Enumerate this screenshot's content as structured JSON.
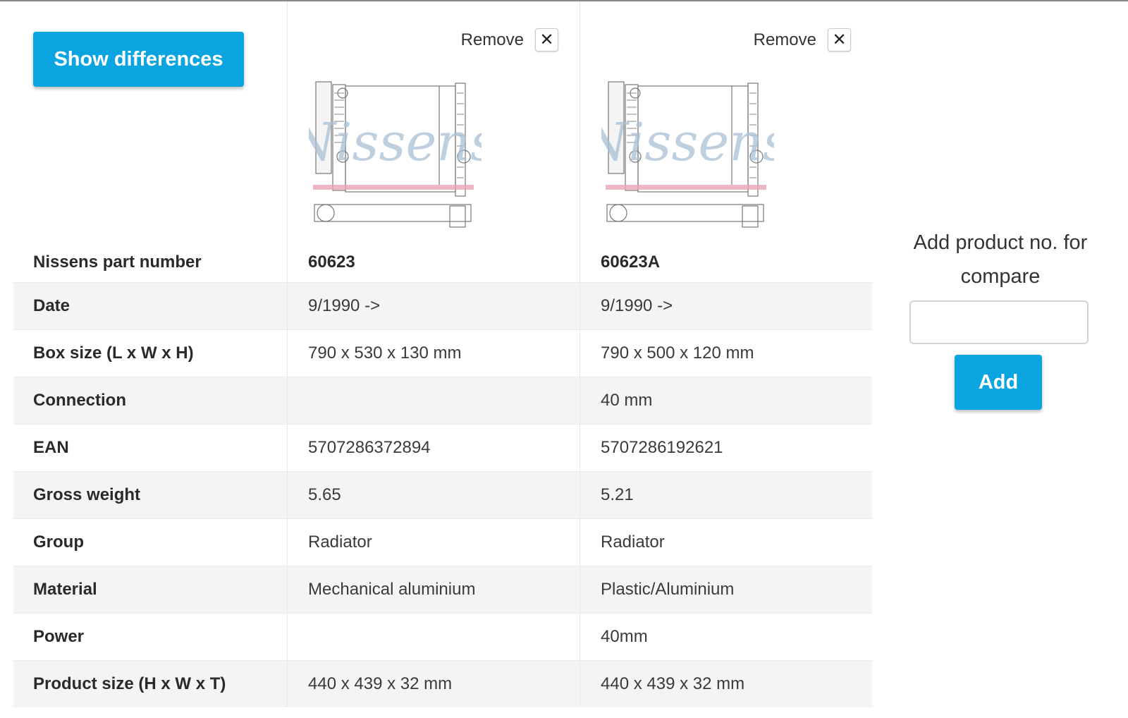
{
  "actions": {
    "show_differences_label": "Show differences",
    "remove_label": "Remove",
    "remove_icon": "✕"
  },
  "part_number_label": "Nissens part number",
  "products": [
    {
      "part_number": "60623",
      "image_watermark": "Nissens"
    },
    {
      "part_number": "60623A",
      "image_watermark": "Nissens"
    }
  ],
  "rows": [
    {
      "label": "Date",
      "values": [
        "9/1990 ->",
        "9/1990 ->"
      ]
    },
    {
      "label": "Box size (L x W x H)",
      "values": [
        "790 x 530 x 130 mm",
        "790 x 500 x 120 mm"
      ]
    },
    {
      "label": "Connection",
      "values": [
        "",
        "40 mm"
      ]
    },
    {
      "label": "EAN",
      "values": [
        "5707286372894",
        "5707286192621"
      ]
    },
    {
      "label": "Gross weight",
      "values": [
        "5.65",
        "5.21"
      ]
    },
    {
      "label": "Group",
      "values": [
        "Radiator",
        "Radiator"
      ]
    },
    {
      "label": "Material",
      "values": [
        "Mechanical aluminium",
        "Plastic/Aluminium"
      ]
    },
    {
      "label": "Power",
      "values": [
        "",
        "40mm"
      ]
    },
    {
      "label": "Product size (H x W x T)",
      "values": [
        "440 x 439 x 32 mm",
        "440 x 439 x 32 mm"
      ]
    }
  ],
  "add_panel": {
    "title_line1": "Add product no. for",
    "title_line2": "compare",
    "input_value": "",
    "input_placeholder": "",
    "add_label": "Add"
  },
  "colors": {
    "accent": "#0aa5e0",
    "row_shade": "#f3f4f6",
    "divider": "#e6e8ea"
  }
}
